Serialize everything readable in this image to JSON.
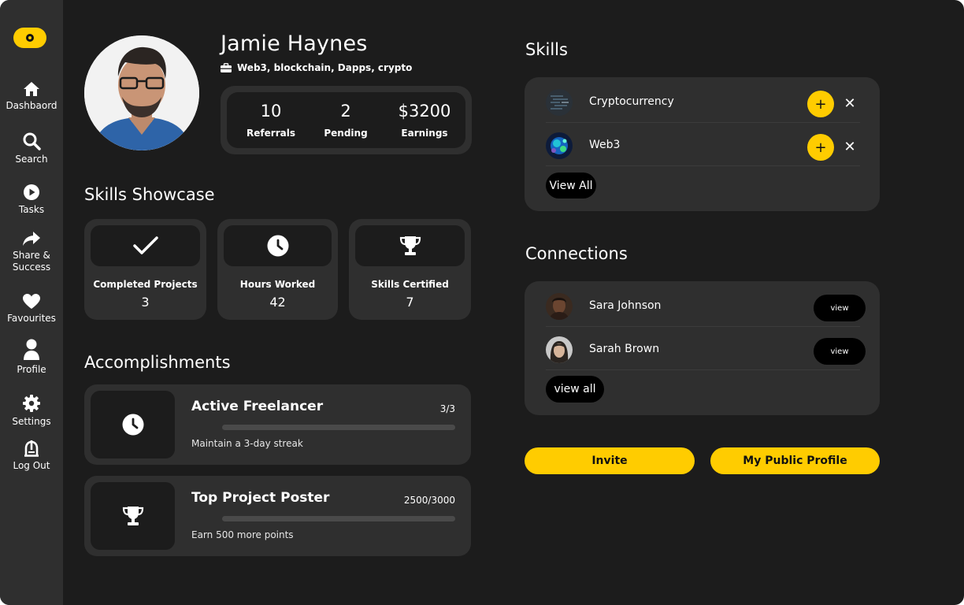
{
  "sidebar": {
    "items": [
      {
        "label": "Dashbaord",
        "icon": "home-icon"
      },
      {
        "label": "Search",
        "icon": "search-icon"
      },
      {
        "label": "Tasks",
        "icon": "play-icon"
      },
      {
        "label": "Share & Success",
        "icon": "share-icon"
      },
      {
        "label": "Favourites",
        "icon": "heart-icon"
      },
      {
        "label": "Profile",
        "icon": "user-icon"
      },
      {
        "label": "Settings",
        "icon": "gear-icon"
      },
      {
        "label": "Log Out",
        "icon": "logout-icon"
      }
    ]
  },
  "profile": {
    "name": "Jamie Haynes",
    "tagline": "Web3, blockchain, Dapps, crypto",
    "stats": [
      {
        "value": "10",
        "label": "Referrals"
      },
      {
        "value": "2",
        "label": "Pending"
      },
      {
        "value": "$3200",
        "label": "Earnings"
      }
    ]
  },
  "skills_showcase": {
    "title": "Skills Showcase",
    "cards": [
      {
        "label": "Completed Projects",
        "value": "3",
        "icon": "check-icon"
      },
      {
        "label": "Hours Worked",
        "value": "42",
        "icon": "clock-icon"
      },
      {
        "label": "Skills Certified",
        "value": "7",
        "icon": "trophy-icon"
      }
    ]
  },
  "accomplishments": {
    "title": "Accomplishments",
    "items": [
      {
        "title": "Active Freelancer",
        "count": "3/3",
        "description": "Maintain a 3-day streak",
        "progress": 0,
        "icon": "clock-icon"
      },
      {
        "title": "Top Project Poster",
        "count": "2500/3000",
        "description": "Earn 500 more points",
        "progress": 0,
        "icon": "trophy-icon"
      }
    ]
  },
  "skills": {
    "title": "Skills",
    "items": [
      {
        "label": "Cryptocurrency"
      },
      {
        "label": "Web3"
      }
    ],
    "view_all_label": "View All"
  },
  "connections": {
    "title": "Connections",
    "items": [
      {
        "name": "Sara Johnson",
        "action": "view"
      },
      {
        "name": "Sarah Brown",
        "action": "view"
      }
    ],
    "view_all_label": "view all"
  },
  "actions": {
    "invite_label": "Invite",
    "public_profile_label": "My Public Profile"
  },
  "colors": {
    "accent": "#ffcc00",
    "background": "#1c1c1c",
    "card": "#2f2f2f"
  }
}
